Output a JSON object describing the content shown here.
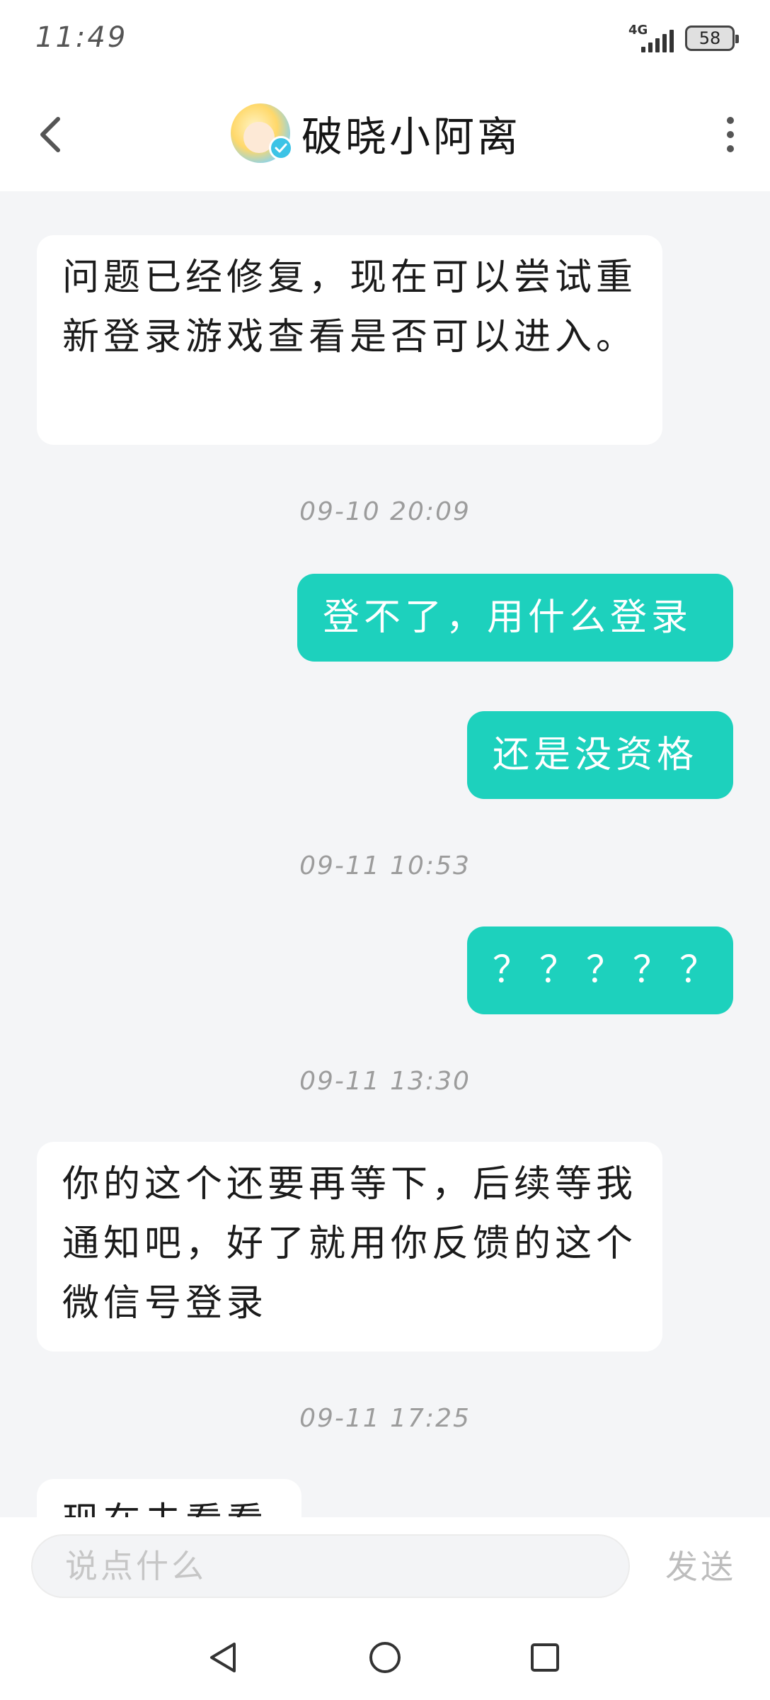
{
  "status_bar": {
    "time": "11:49",
    "network": "4G",
    "battery": "58"
  },
  "header": {
    "title": "破晓小阿离"
  },
  "messages": [
    {
      "type": "in",
      "text": "问题已经修复，现在可以尝试重新登录游戏查看是否可以进入。"
    },
    {
      "type": "time",
      "text": "09-10 20:09"
    },
    {
      "type": "out",
      "text": "登不了，用什么登录"
    },
    {
      "type": "out",
      "text": "还是没资格"
    },
    {
      "type": "time",
      "text": "09-11 10:53"
    },
    {
      "type": "out",
      "text": "？？？？？"
    },
    {
      "type": "time",
      "text": "09-11 13:30"
    },
    {
      "type": "in",
      "text": "你的这个还要再等下，后续等我通知吧，好了就用你反馈的这个微信号登录"
    },
    {
      "type": "time",
      "text": "09-11 17:25"
    },
    {
      "type": "in",
      "text": "现在去看看"
    }
  ],
  "input": {
    "placeholder": "说点什么",
    "send_label": "发送"
  },
  "colors": {
    "outgoing_bubble": "#1dd1bd",
    "incoming_bubble": "#ffffff",
    "background": "#f4f5f7"
  },
  "icons": {
    "back": "chevron-left-icon",
    "more": "more-vertical-icon",
    "nav_back": "triangle-back-icon",
    "nav_home": "circle-home-icon",
    "nav_recents": "square-recents-icon"
  }
}
